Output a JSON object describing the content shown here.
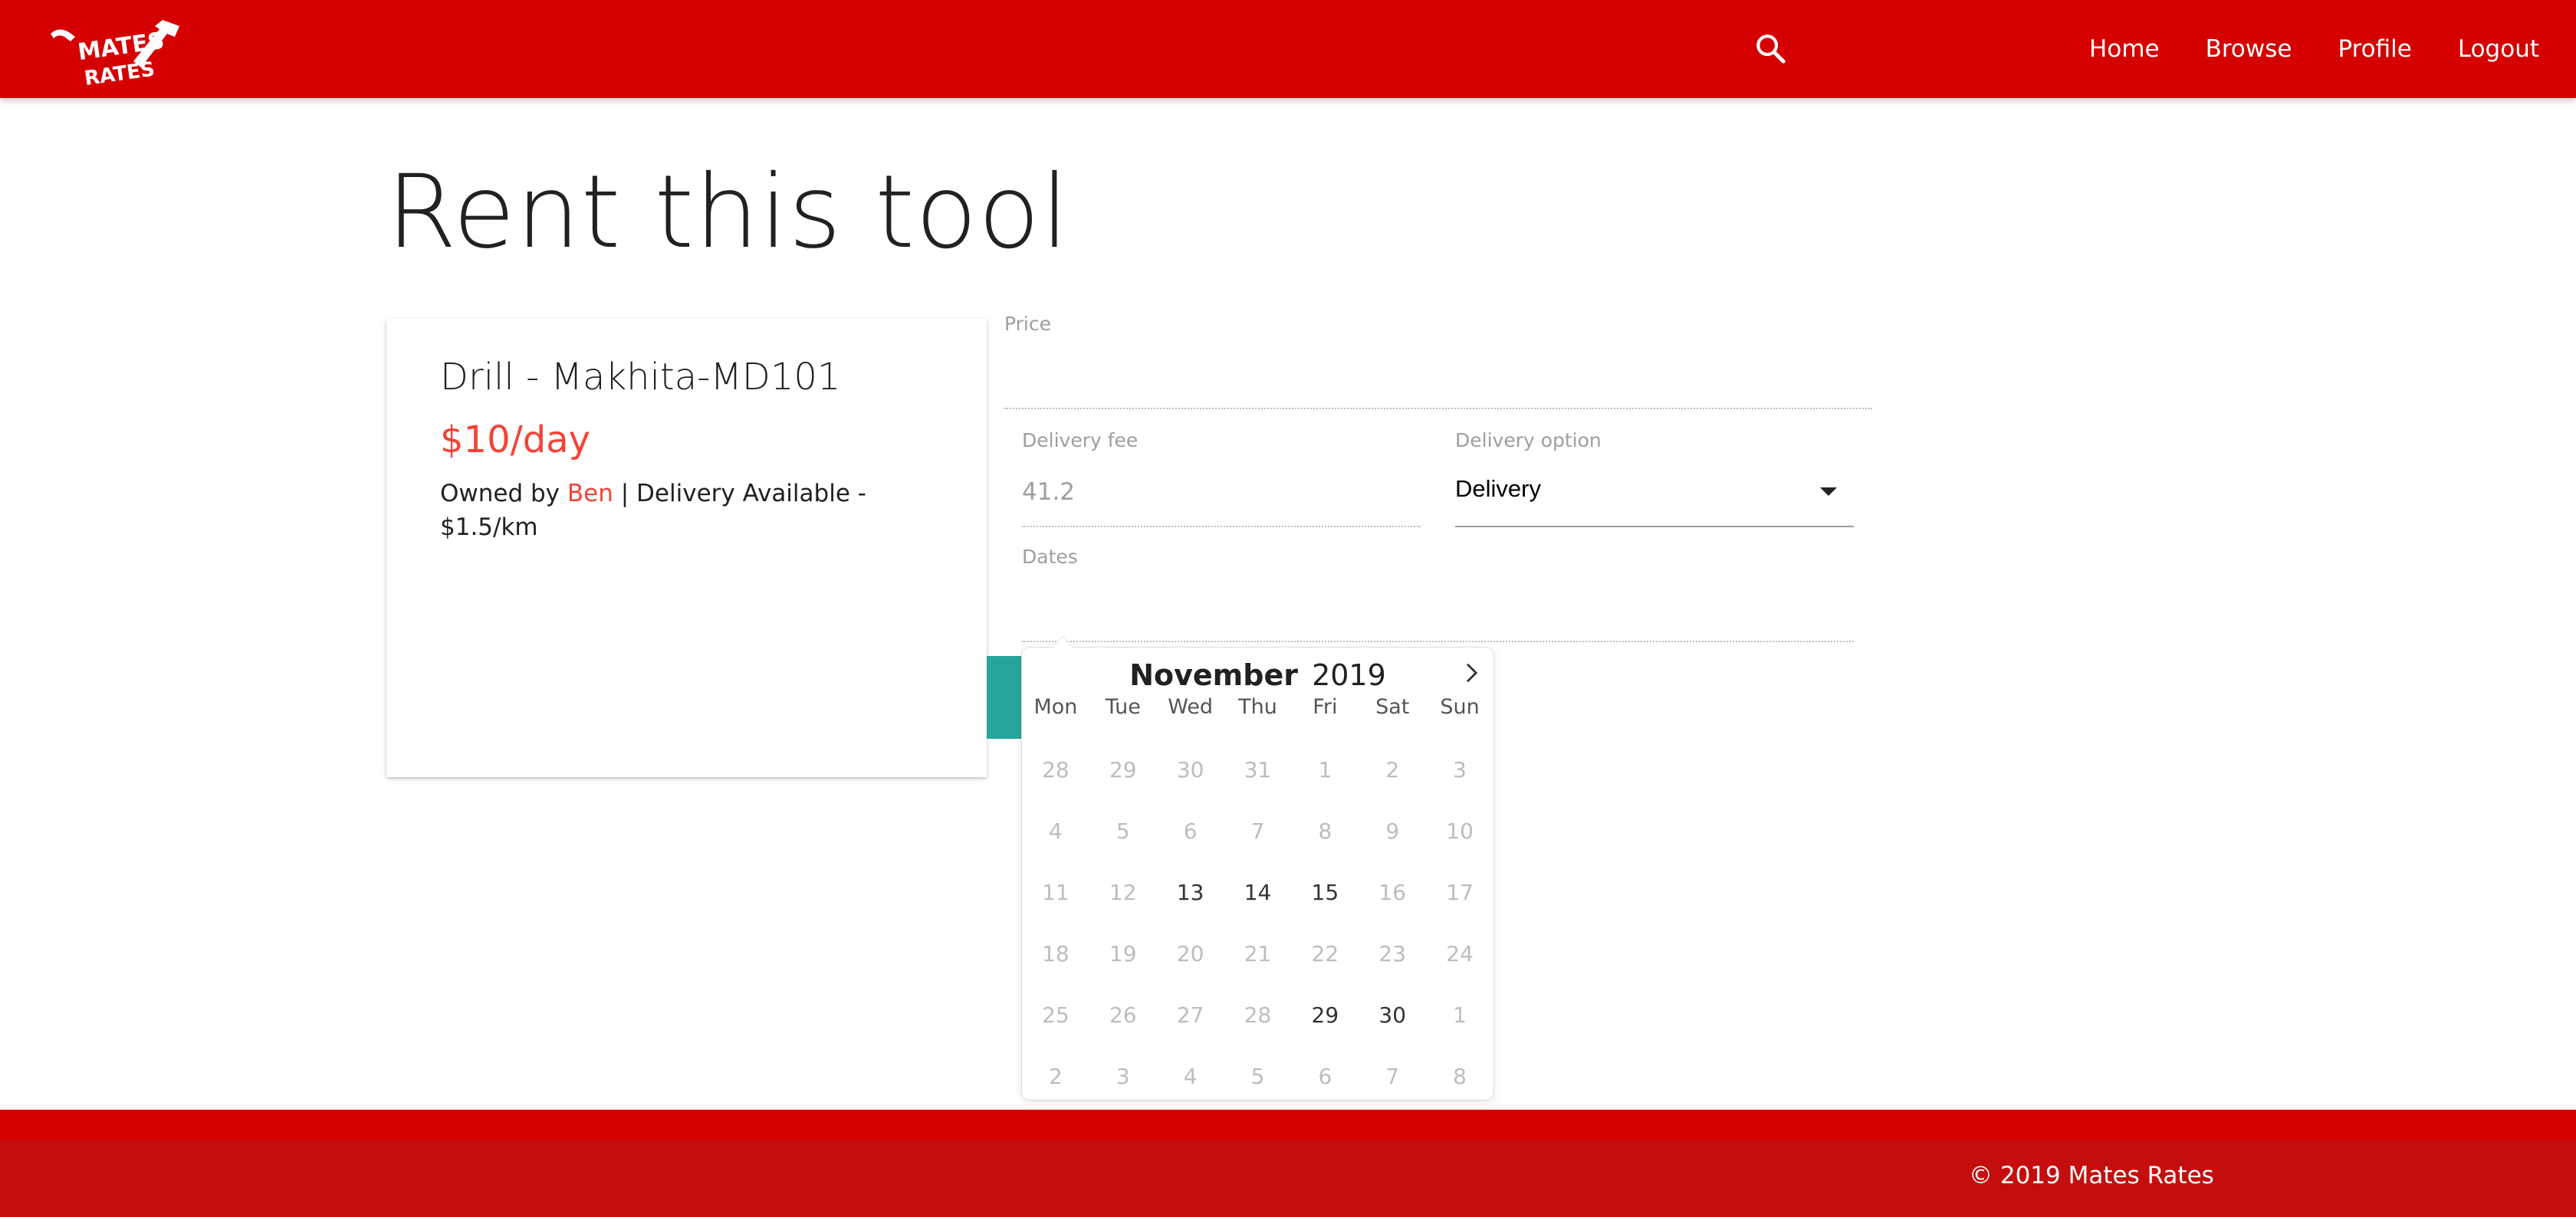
{
  "navbar": {
    "logo_text": "MATES RATES",
    "search_icon": "search-icon",
    "links": [
      "Home",
      "Browse",
      "Profile",
      "Logout"
    ],
    "background": "#d50000"
  },
  "page": {
    "title": "Rent this tool"
  },
  "tool": {
    "name": "Drill - Makhita-MD101",
    "price": "$10/day",
    "owned_by_label": "Owned by",
    "owner": "Ben",
    "delivery_text": "| Delivery Available - $1.5/km"
  },
  "form": {
    "price_label": "Price",
    "delivery_fee_label": "Delivery fee",
    "delivery_fee_value": "41.2",
    "delivery_option_label": "Delivery option",
    "delivery_option_value": "Delivery",
    "dates_label": "Dates",
    "accent_color": "#26a69a"
  },
  "calendar": {
    "month": "November",
    "year": "2019",
    "weekdays": [
      "Mon",
      "Tue",
      "Wed",
      "Thu",
      "Fri",
      "Sat",
      "Sun"
    ],
    "days": [
      {
        "label": "28",
        "enabled": false
      },
      {
        "label": "29",
        "enabled": false
      },
      {
        "label": "30",
        "enabled": false
      },
      {
        "label": "31",
        "enabled": false
      },
      {
        "label": "1",
        "enabled": false
      },
      {
        "label": "2",
        "enabled": false
      },
      {
        "label": "3",
        "enabled": false
      },
      {
        "label": "4",
        "enabled": false
      },
      {
        "label": "5",
        "enabled": false
      },
      {
        "label": "6",
        "enabled": false
      },
      {
        "label": "7",
        "enabled": false
      },
      {
        "label": "8",
        "enabled": false
      },
      {
        "label": "9",
        "enabled": false
      },
      {
        "label": "10",
        "enabled": false
      },
      {
        "label": "11",
        "enabled": false
      },
      {
        "label": "12",
        "enabled": false
      },
      {
        "label": "13",
        "enabled": true
      },
      {
        "label": "14",
        "enabled": true
      },
      {
        "label": "15",
        "enabled": true
      },
      {
        "label": "16",
        "enabled": false
      },
      {
        "label": "17",
        "enabled": false
      },
      {
        "label": "18",
        "enabled": false
      },
      {
        "label": "19",
        "enabled": false
      },
      {
        "label": "20",
        "enabled": false
      },
      {
        "label": "21",
        "enabled": false
      },
      {
        "label": "22",
        "enabled": false
      },
      {
        "label": "23",
        "enabled": false
      },
      {
        "label": "24",
        "enabled": false
      },
      {
        "label": "25",
        "enabled": false
      },
      {
        "label": "26",
        "enabled": false
      },
      {
        "label": "27",
        "enabled": false
      },
      {
        "label": "28",
        "enabled": false
      },
      {
        "label": "29",
        "enabled": true
      },
      {
        "label": "30",
        "enabled": true
      },
      {
        "label": "1",
        "enabled": false
      },
      {
        "label": "2",
        "enabled": false
      },
      {
        "label": "3",
        "enabled": false
      },
      {
        "label": "4",
        "enabled": false
      },
      {
        "label": "5",
        "enabled": false
      },
      {
        "label": "6",
        "enabled": false
      },
      {
        "label": "7",
        "enabled": false
      },
      {
        "label": "8",
        "enabled": false
      }
    ]
  },
  "footer": {
    "copyright": "© 2019 Mates Rates"
  }
}
